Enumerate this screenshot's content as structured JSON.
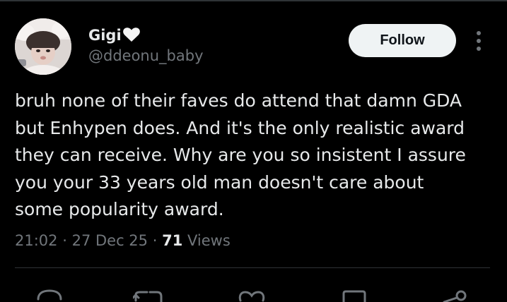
{
  "user": {
    "display_name": "Gigi",
    "handle": "@ddeonu_baby",
    "badge_icon": "white-heart-icon"
  },
  "follow_label": "Follow",
  "tweet": {
    "lines": [
      "bruh none of their faves do attend that damn GDA",
      "but Enhypen does. And it's the only realistic award",
      "they can receive. Why are you so insistent I assure",
      "you your 33 years old man doesn't care about",
      "some popularity award."
    ]
  },
  "meta": {
    "time": "21:02",
    "date": "27 Dec 25",
    "separator": "·",
    "views_count": "71",
    "views_label": "Views"
  },
  "actions": [
    "reply-icon",
    "retweet-icon",
    "like-icon",
    "bookmark-icon",
    "share-icon"
  ],
  "colors": {
    "background": "#000000",
    "text": "#e7e9ea",
    "secondary": "#71767b",
    "divider": "#2f3336",
    "button_bg": "#eff3f4",
    "button_text": "#0f1419"
  }
}
